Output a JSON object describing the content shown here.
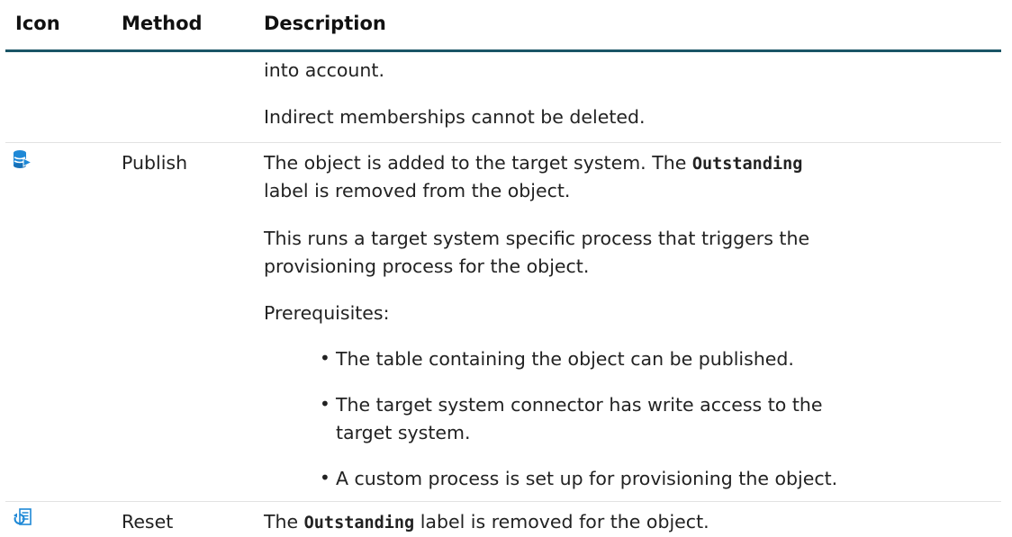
{
  "header": {
    "col_icon": "Icon",
    "col_method": "Method",
    "col_description": "Description"
  },
  "continuation": {
    "line1": "into account.",
    "line2": "Indirect memberships cannot be deleted."
  },
  "rows": [
    {
      "icon": "publish-database-icon",
      "method": "Publish",
      "p1_pre": "The object is added to the target system. The ",
      "p1_code": "Outstanding",
      "p1_line2": "label is removed from the object.",
      "p2_line1": "This runs a target system specific process that triggers the",
      "p2_line2": "provisioning process for the object.",
      "prereq_label": "Prerequisites:",
      "bullets": [
        "The table containing the object can be published.",
        "The target system connector has write access to the",
        "target system.",
        "A custom process is set up for provisioning the object."
      ]
    },
    {
      "icon": "reset-document-icon",
      "method": "Reset",
      "p1_pre": "The ",
      "p1_code": "Outstanding",
      "p1_post": " label is removed for the object."
    }
  ],
  "colors": {
    "header_rule": "#1a5566",
    "row_rule": "#e2e2e2",
    "icon_blue": "#1e88d6"
  }
}
